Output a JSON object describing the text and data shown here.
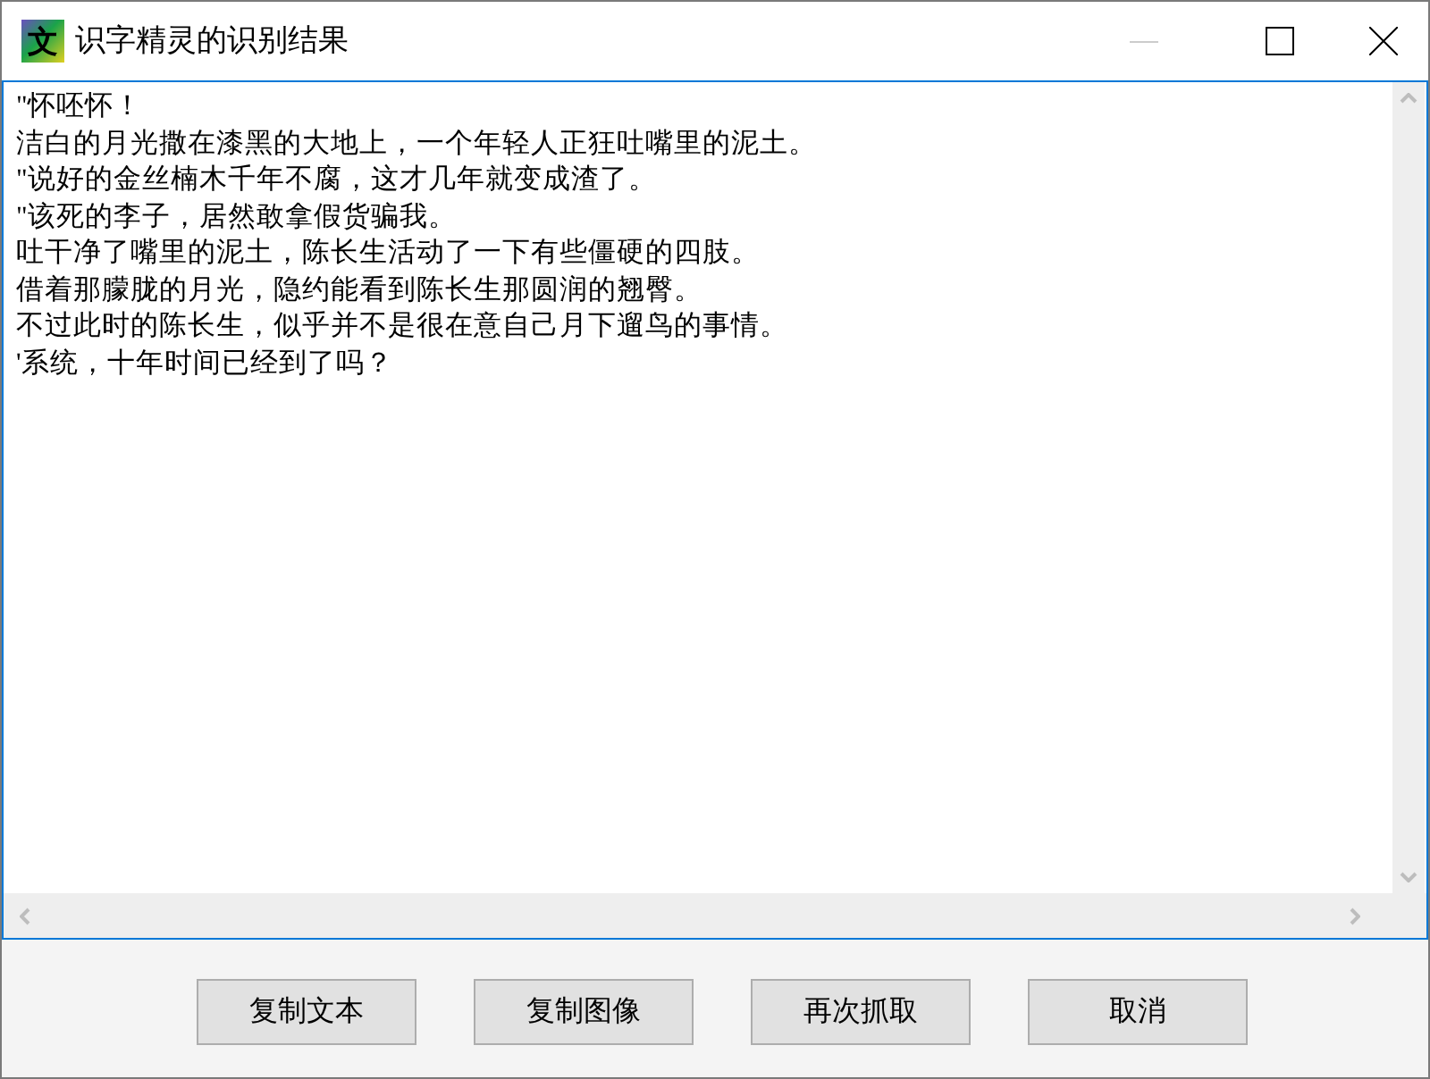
{
  "window": {
    "logo_text": "文",
    "title": "识字精灵的识别结果",
    "minimize_disabled": true
  },
  "text_lines": [
    "\"怀呸怀！",
    "洁白的月光撒在漆黑的大地上，一个年轻人正狂吐嘴里的泥土。",
    "\"说好的金丝楠木千年不腐，这才几年就变成渣了。",
    "\"该死的李子，居然敢拿假货骗我。",
    "吐干净了嘴里的泥土，陈长生活动了一下有些僵硬的四肢。",
    "借着那朦胧的月光，隐约能看到陈长生那圆润的翘臀。",
    "不过此时的陈长生，似乎并不是很在意自己月下遛鸟的事情。",
    "'系统，十年时间已经到了吗？"
  ],
  "buttons": [
    "复制文本",
    "复制图像",
    "再次抓取",
    "取消"
  ]
}
